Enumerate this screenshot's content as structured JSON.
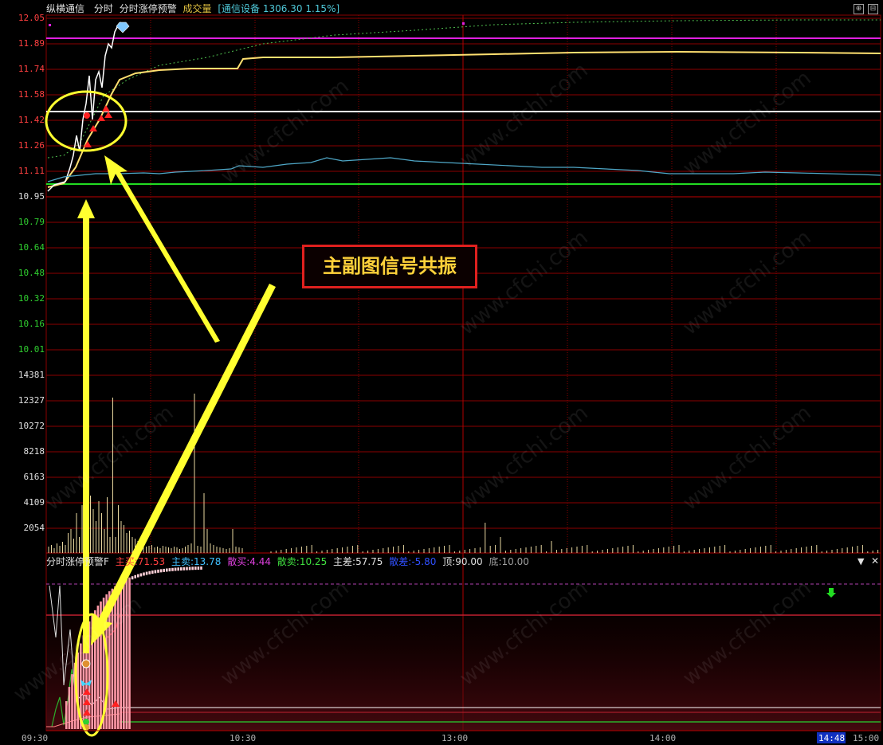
{
  "header": {
    "stock_name": "纵横通信",
    "view_mode": "分时",
    "indicator_name": "分时涨停预警",
    "volume_label": "成交量",
    "sector_label": "[通信设备",
    "sector_value": "1306.30",
    "sector_change": "1.15%]"
  },
  "price_axis": [
    "12.05",
    "11.89",
    "11.74",
    "11.58",
    "11.42",
    "11.26",
    "11.11",
    "10.95",
    "10.79",
    "10.64",
    "10.48",
    "10.32",
    "10.16",
    "10.01"
  ],
  "volume_axis": [
    "14381",
    "12327",
    "10272",
    "8218",
    "6163",
    "4109",
    "2054"
  ],
  "time_axis": [
    "09:30",
    "10:30",
    "13:00",
    "14:00",
    "15:00"
  ],
  "cursor_time": "14:48",
  "sub_header": {
    "name": "分时涨停预警F",
    "main_buy_label": "主买:",
    "main_buy_value": "71.53",
    "main_sell_label": "主卖:",
    "main_sell_value": "13.78",
    "retail_buy_label": "散买:",
    "retail_buy_value": "4.44",
    "retail_sell_label": "散卖:",
    "retail_sell_value": "10.25",
    "main_diff_label": "主差:",
    "main_diff_value": "57.75",
    "retail_diff_label": "散差:",
    "retail_diff_value": "-5.80",
    "top_label": "顶:",
    "top_value": "90.00",
    "bottom_label": "底:",
    "bottom_value": "10.00"
  },
  "callout_text": "主副图信号共振",
  "watermark": "www.cfchi.com",
  "colors": {
    "grid": "#8b0000",
    "price_line": "#ffffff",
    "avg_line": "#ffff80",
    "sector_line": "#4fa8c8",
    "limit_up_line": "#e020e0",
    "prev_close_line": "#22dd22",
    "annotation": "#ffff30",
    "callout_border": "#e0201e"
  },
  "icons": [
    "diamond-icon",
    "down-arrow-icon",
    "dropdown-icon",
    "close-icon",
    "zoom-icon",
    "settings-icon"
  ]
}
